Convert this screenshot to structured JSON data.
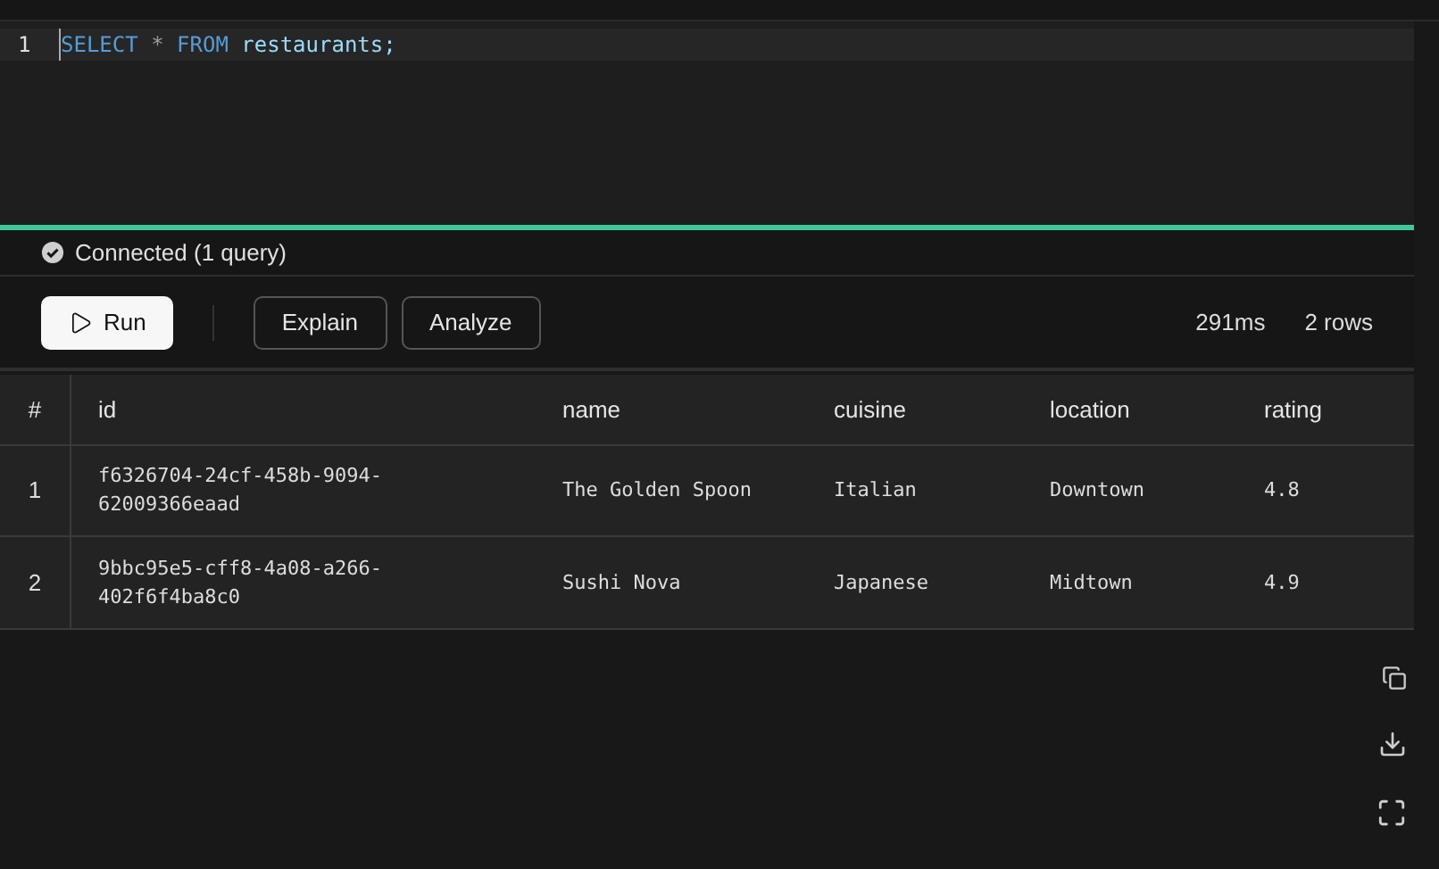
{
  "editor": {
    "lines": [
      {
        "number": "1",
        "tokens": [
          {
            "kind": "keyword",
            "text": "SELECT"
          },
          {
            "kind": "operator",
            "text": "*"
          },
          {
            "kind": "keyword",
            "text": "FROM"
          },
          {
            "kind": "identifier",
            "text": "restaurants;"
          }
        ]
      }
    ]
  },
  "status": {
    "text": "Connected (1 query)"
  },
  "toolbar": {
    "run": "Run",
    "buttons": [
      "Explain",
      "Analyze"
    ],
    "duration": "291ms",
    "row_count": "2 rows"
  },
  "table": {
    "columns": [
      "#",
      "id",
      "name",
      "cuisine",
      "location",
      "rating"
    ],
    "rows": [
      [
        "1",
        "f6326704-24cf-458b-9094-62009366eaad",
        "The Golden Spoon",
        "Italian",
        "Downtown",
        "4.8"
      ],
      [
        "2",
        "9bbc95e5-cff8-4a08-a266-402f6f4ba8c0",
        "Sushi Nova",
        "Japanese",
        "Midtown",
        "4.9"
      ]
    ]
  }
}
